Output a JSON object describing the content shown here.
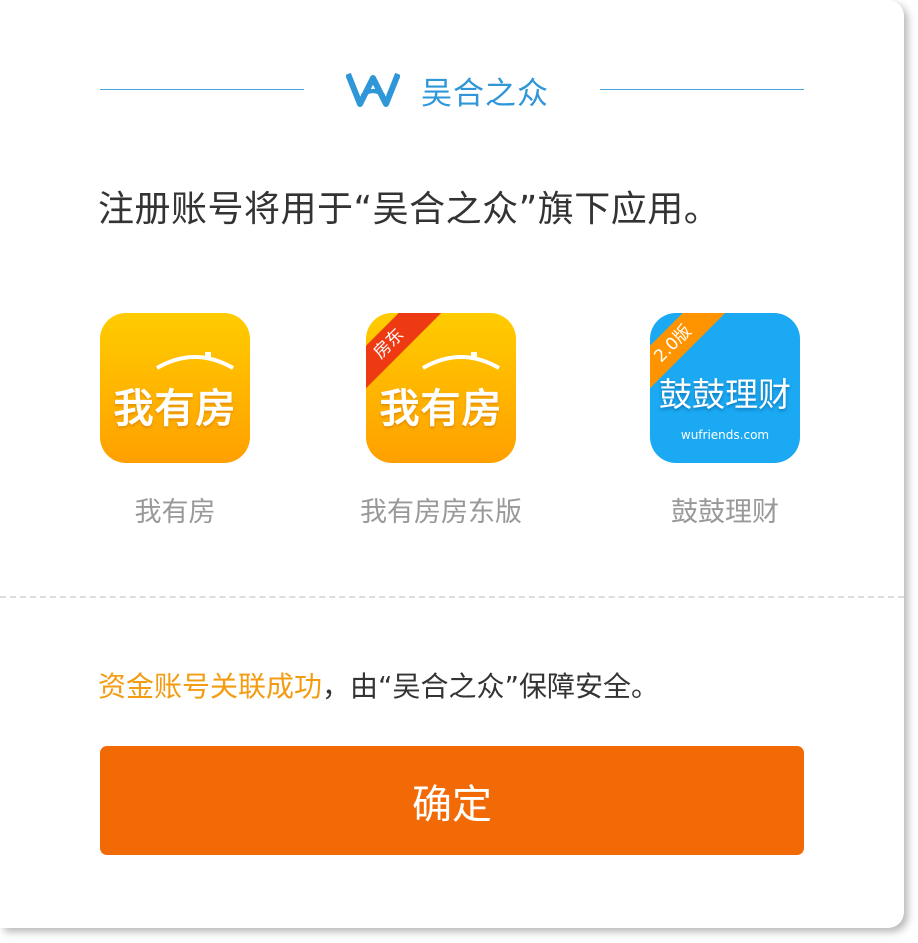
{
  "brand": {
    "name": "吴合之众",
    "logo_icon": "wuhe-w-logo-icon",
    "color": "#2f97d8"
  },
  "intro_text": "注册账号将用于“吴合之众”旗下应用。",
  "apps": [
    {
      "label": "我有房",
      "icon_text": "我有房",
      "icon": "house-roof-icon",
      "ribbon": ""
    },
    {
      "label": "我有房房东版",
      "icon_text": "我有房",
      "icon": "house-roof-icon",
      "ribbon": "房东"
    },
    {
      "label": "鼓鼓理财",
      "icon_text": "鼓鼓理财",
      "icon": "wallet-app-icon",
      "ribbon": "2.0版",
      "domain": "wufriends.com"
    }
  ],
  "status": {
    "highlight": "资金账号关联成功",
    "rest": "，由“吴合之众”保障安全。",
    "highlight_color": "#f39c12"
  },
  "confirm_label": "确定",
  "colors": {
    "accent": "#f26a05",
    "brand_blue": "#2f97d8",
    "app_orange": "#ffb000",
    "app_blue": "#1aa9f2"
  }
}
